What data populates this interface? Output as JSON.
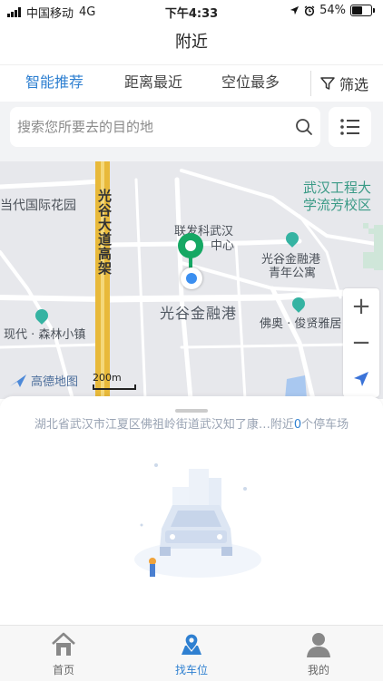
{
  "status_bar": {
    "carrier": "中国移动",
    "network": "4G",
    "time": "下午4:33",
    "battery": "54%",
    "battery_level": 0.54
  },
  "nav": {
    "title": "附近"
  },
  "tabs": [
    {
      "label": "智能推荐",
      "active": true
    },
    {
      "label": "距离最近",
      "active": false
    },
    {
      "label": "空位最多",
      "active": false
    }
  ],
  "filter": {
    "label": "筛选",
    "icon": "filter-icon"
  },
  "search": {
    "placeholder": "搜索您所要去的目的地",
    "icon": "search-icon",
    "list_icon": "list-icon"
  },
  "map": {
    "labels": {
      "estate_left": "当代国际花园",
      "univ_line1": "武汉工程大",
      "univ_line2": "学流芳校区",
      "road": "光谷大道高架",
      "lianfa_line1": "联发科武汉",
      "lianfa_line2": "中心",
      "gjr_youth_line1": "光谷金融港",
      "gjr_youth_line2": "青年公寓",
      "gjr_main": "光谷金融港",
      "senlin": "现代 · 森林小镇",
      "foao": "佛奥 · 俊贤雅居"
    },
    "logo": "高德地图",
    "scale": "200m",
    "controls": {
      "zoom_in": "+",
      "zoom_out": "−"
    },
    "colors": {
      "background": "#e7e8ec",
      "highway": "#e8b93a",
      "pin": "#16a864",
      "location_dot": "#3b8ff0"
    }
  },
  "panel": {
    "address": "湖北省武汉市江夏区佛祖岭街道武汉知了康…",
    "nearby_prefix": "附近",
    "nearby_count": "0",
    "nearby_suffix": "个停车场"
  },
  "tabbar": [
    {
      "label": "首页",
      "icon": "home-icon",
      "active": false
    },
    {
      "label": "找车位",
      "icon": "map-pin-icon",
      "active": true
    },
    {
      "label": "我的",
      "icon": "profile-icon",
      "active": false
    }
  ],
  "colors": {
    "accent": "#2f80d1",
    "muted": "#9aa4b4"
  }
}
